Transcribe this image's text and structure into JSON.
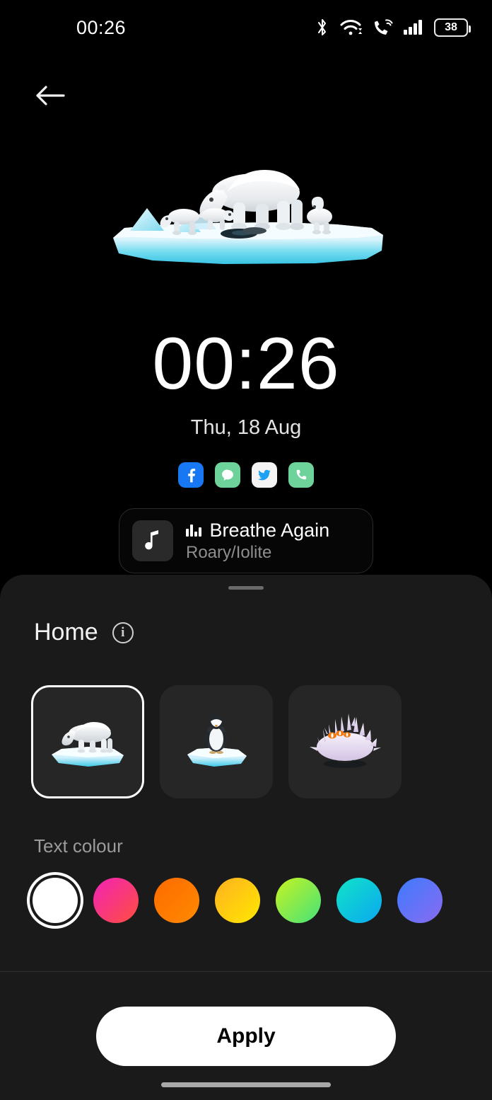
{
  "statusbar": {
    "time": "00:26",
    "battery_level": "38",
    "icons": [
      "bluetooth-icon",
      "wifi-icon",
      "vowifi-call-icon",
      "cellular-signal-icon",
      "battery-icon"
    ]
  },
  "navigation": {
    "back_icon": "back-arrow-icon"
  },
  "wallpaper_preview": {
    "art_name": "polar-bear-on-ice-illustration",
    "clock": "00:26",
    "date": "Thu, 18 Aug",
    "shortcuts": [
      {
        "name": "facebook",
        "icon": "facebook-icon",
        "color": "#1877F2"
      },
      {
        "name": "messages",
        "icon": "messages-icon",
        "color": "#6ed39a"
      },
      {
        "name": "twitter",
        "icon": "twitter-icon",
        "color": "#f4f4f4"
      },
      {
        "name": "phone",
        "icon": "phone-icon",
        "color": "#6ed39a"
      }
    ],
    "music_widget": {
      "title": "Breathe Again",
      "artist": "Roary/Iolite",
      "album_art_icon": "music-note-icon",
      "playing_icon": "equalizer-bars-icon"
    }
  },
  "sheet": {
    "title": "Home",
    "info_icon_label": "i",
    "thumbnails": [
      {
        "label": "polar-bear-wallpaper",
        "selected": true
      },
      {
        "label": "penguin-wallpaper",
        "selected": false
      },
      {
        "label": "coral-wallpaper",
        "selected": false
      }
    ],
    "text_colour": {
      "label": "Text colour",
      "swatches": [
        {
          "name": "white",
          "selected": true,
          "from": "#ffffff",
          "to": "#ffffff"
        },
        {
          "name": "pink-red",
          "selected": false,
          "from": "#f222b8",
          "to": "#ff4f3d"
        },
        {
          "name": "orange",
          "selected": false,
          "from": "#fd6a00",
          "to": "#ff8a00"
        },
        {
          "name": "yellow",
          "selected": false,
          "from": "#ffb020",
          "to": "#ffe800"
        },
        {
          "name": "green",
          "selected": false,
          "from": "#c8f321",
          "to": "#44e27a"
        },
        {
          "name": "cyan",
          "selected": false,
          "from": "#12e3c8",
          "to": "#0aa8f0"
        },
        {
          "name": "blue-purple",
          "selected": false,
          "from": "#3d7bff",
          "to": "#8a6bf0"
        }
      ]
    },
    "apply_label": "Apply"
  }
}
